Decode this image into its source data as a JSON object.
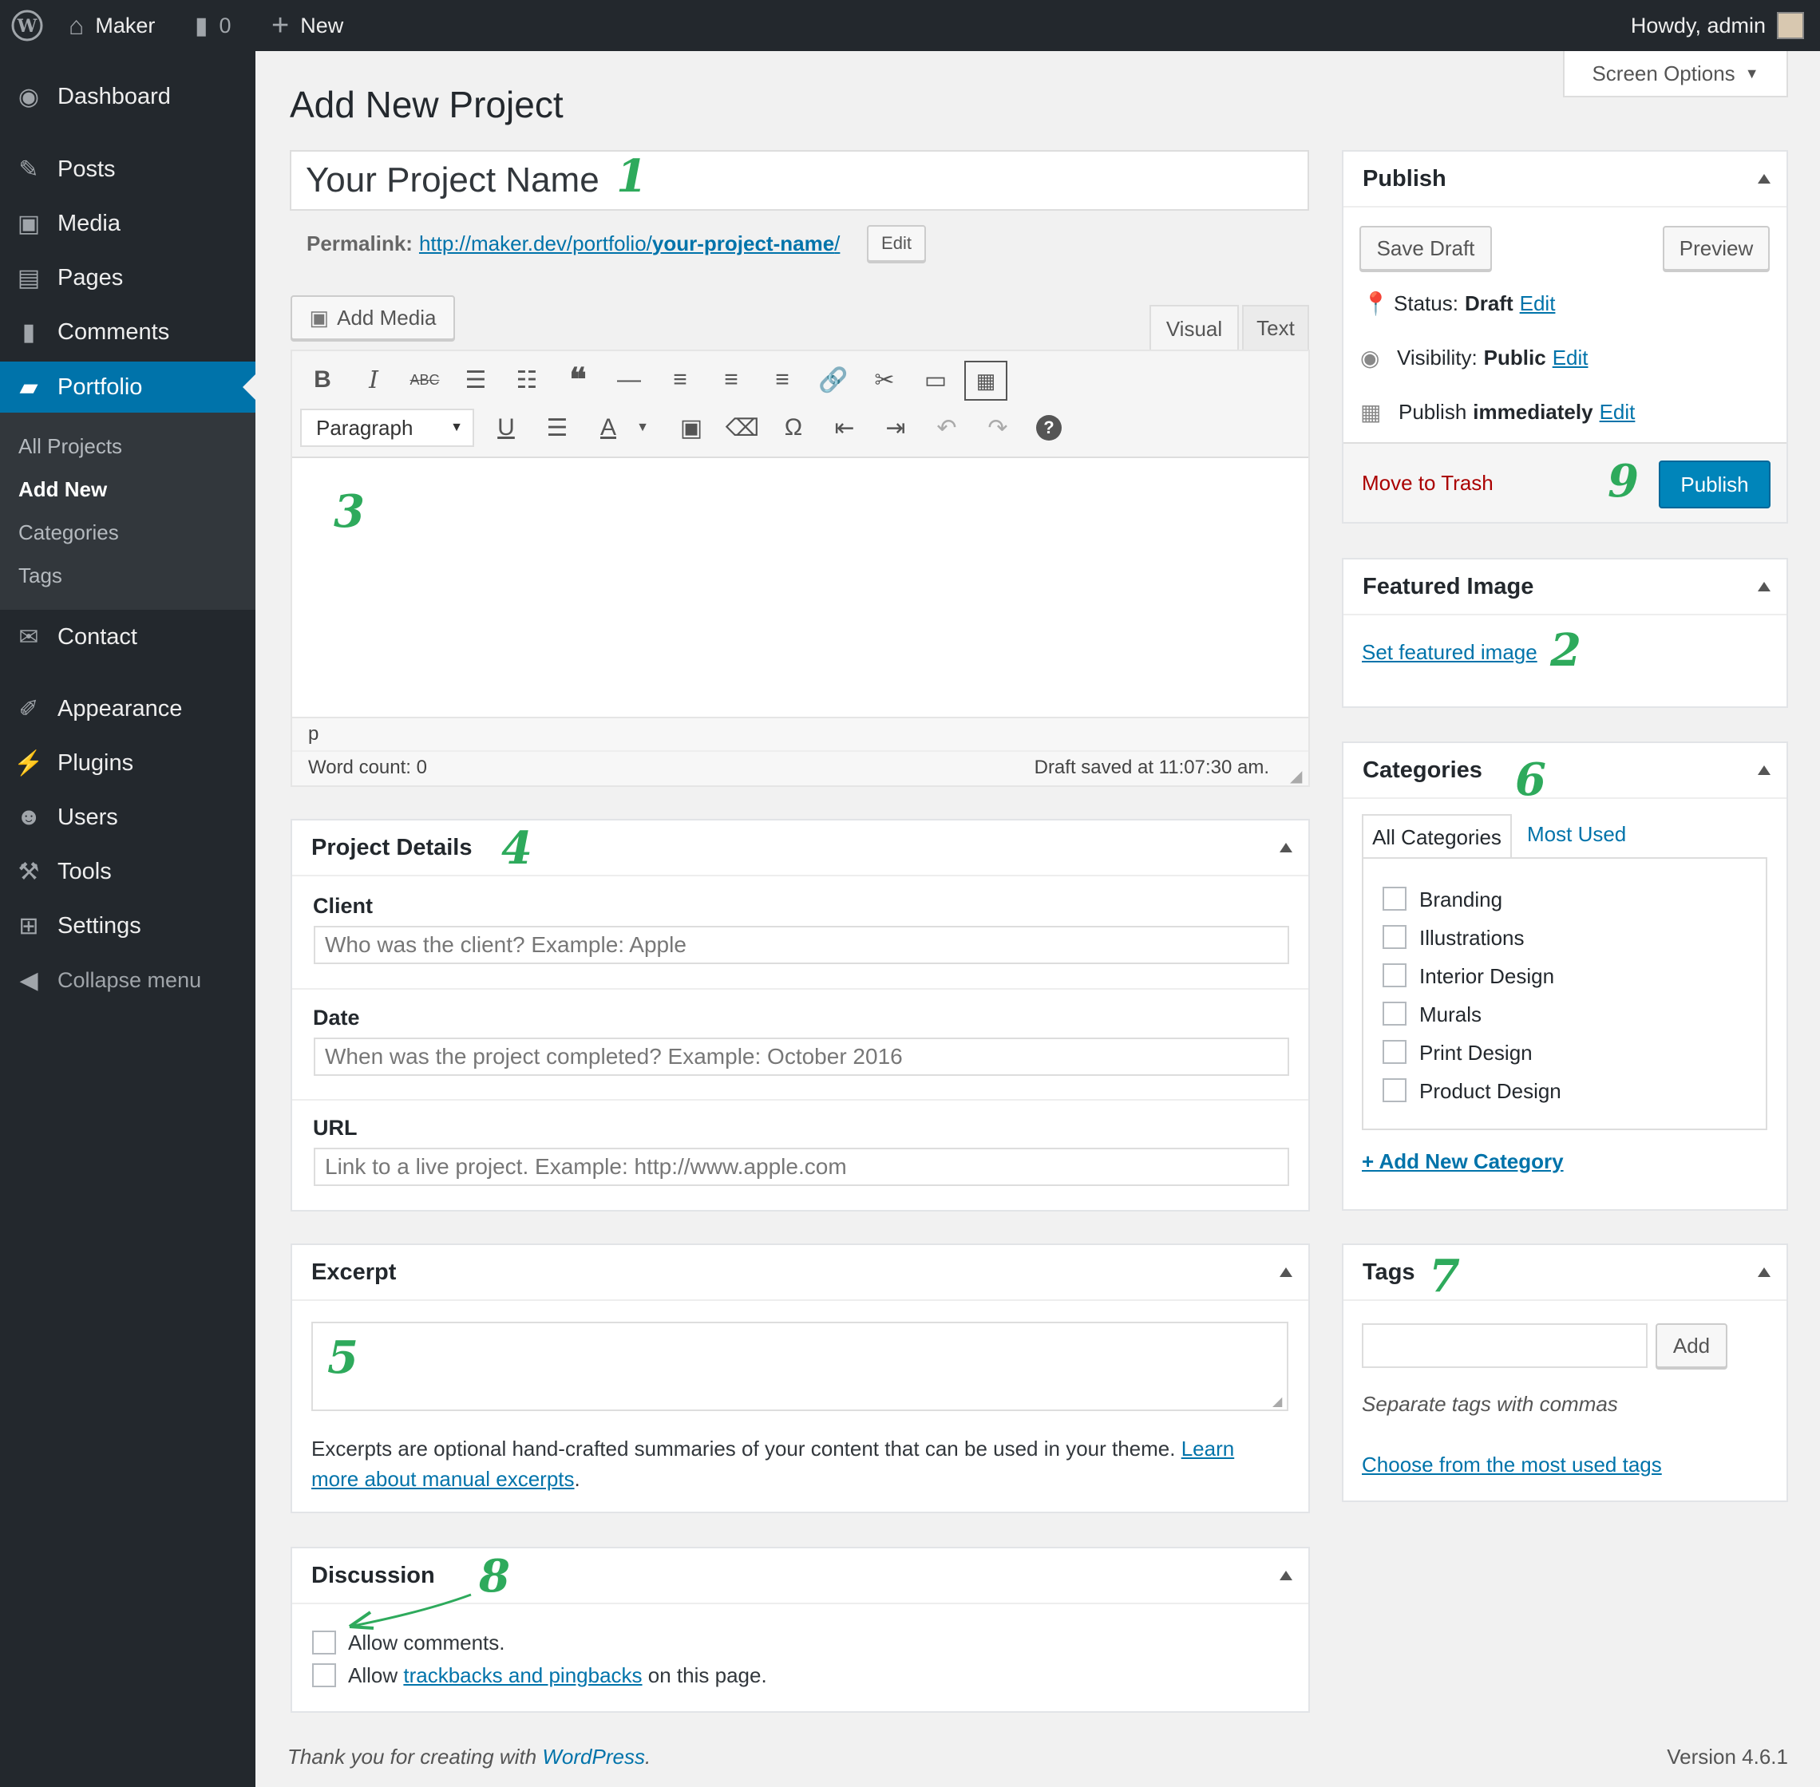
{
  "adminbar": {
    "site_name": "Maker",
    "comments_count": "0",
    "new_label": "New",
    "howdy": "Howdy, admin"
  },
  "screen_options": "Screen Options",
  "sidebar": {
    "items": [
      {
        "label": "Dashboard",
        "icon": "dashboard-icon"
      },
      {
        "label": "Posts",
        "icon": "pin-icon"
      },
      {
        "label": "Media",
        "icon": "media-icon"
      },
      {
        "label": "Pages",
        "icon": "pages-icon"
      },
      {
        "label": "Comments",
        "icon": "comment-icon"
      },
      {
        "label": "Portfolio",
        "icon": "folder-icon"
      },
      {
        "label": "Contact",
        "icon": "mail-icon"
      },
      {
        "label": "Appearance",
        "icon": "brush-icon"
      },
      {
        "label": "Plugins",
        "icon": "plug-icon"
      },
      {
        "label": "Users",
        "icon": "user-icon"
      },
      {
        "label": "Tools",
        "icon": "wrench-icon"
      },
      {
        "label": "Settings",
        "icon": "settings-icon"
      },
      {
        "label": "Collapse menu",
        "icon": "collapse-icon"
      }
    ],
    "submenu": [
      "All Projects",
      "Add New",
      "Categories",
      "Tags"
    ]
  },
  "page_title": "Add New Project",
  "title_input": "Your Project Name",
  "permalink": {
    "label": "Permalink:",
    "base": "http://maker.dev/portfolio/",
    "slug": "your-project-name",
    "trail": "/",
    "edit": "Edit"
  },
  "editor": {
    "add_media": "Add Media",
    "tab_visual": "Visual",
    "tab_text": "Text",
    "format_select": "Paragraph",
    "path": "p",
    "word_count": "Word count: 0",
    "draft_saved": "Draft saved at 11:07:30 am."
  },
  "project_details": {
    "title": "Project Details",
    "client_label": "Client",
    "client_placeholder": "Who was the client? Example: Apple",
    "date_label": "Date",
    "date_placeholder": "When was the project completed? Example: October 2016",
    "url_label": "URL",
    "url_placeholder": "Link to a live project. Example: http://www.apple.com"
  },
  "excerpt": {
    "title": "Excerpt",
    "help": "Excerpts are optional hand-crafted summaries of your content that can be used in your theme.",
    "learn_1": "Learn",
    "learn_2": "more about manual excerpts",
    "period": "."
  },
  "discussion": {
    "title": "Discussion",
    "allow_comments": "Allow comments.",
    "allow": "Allow",
    "trackbacks_link": "trackbacks and pingbacks",
    "on_page": "on this page."
  },
  "publish": {
    "title": "Publish",
    "save_draft": "Save Draft",
    "preview": "Preview",
    "status_label": "Status:",
    "status_value": "Draft",
    "visibility_label": "Visibility:",
    "visibility_value": "Public",
    "publish_label": "Publish",
    "publish_value": "immediately",
    "edit": "Edit",
    "trash": "Move to Trash",
    "publish_button": "Publish"
  },
  "featured_image": {
    "title": "Featured Image",
    "link": "Set featured image"
  },
  "categories": {
    "title": "Categories",
    "tab_all": "All Categories",
    "tab_used": "Most Used",
    "items": [
      "Branding",
      "Illustrations",
      "Interior Design",
      "Murals",
      "Print Design",
      "Product Design"
    ],
    "add_new": "+ Add New Category"
  },
  "tags": {
    "title": "Tags",
    "add": "Add",
    "help": "Separate tags with commas",
    "choose": "Choose from the most used tags"
  },
  "footer": {
    "thanks": "Thank you for creating with",
    "wp": "WordPress",
    "period": ".",
    "version": "Version 4.6.1"
  },
  "annotations": [
    "1",
    "2",
    "3",
    "4",
    "5",
    "6",
    "7",
    "8",
    "9"
  ],
  "colors": {
    "accent": "#0073aa",
    "adminbar": "#23282d",
    "annotation": "#2eaa5c",
    "trash": "#a00"
  }
}
